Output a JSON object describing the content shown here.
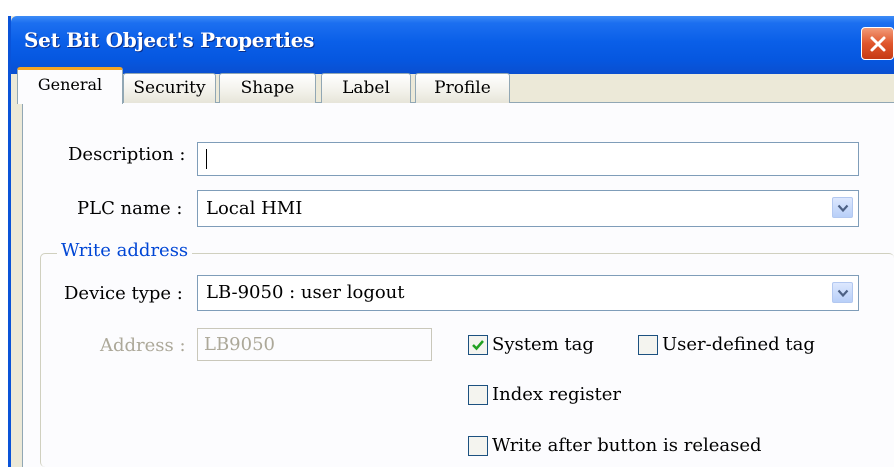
{
  "window": {
    "title": "Set Bit Object's Properties"
  },
  "tabs": [
    {
      "label": "General",
      "active": true
    },
    {
      "label": "Security",
      "active": false
    },
    {
      "label": "Shape",
      "active": false
    },
    {
      "label": "Label",
      "active": false
    },
    {
      "label": "Profile",
      "active": false
    }
  ],
  "general": {
    "description_label": "Description :",
    "description_value": "",
    "plc_name_label": "PLC name :",
    "plc_name_value": "Local HMI",
    "write_address_group": "Write address",
    "device_type_label": "Device type :",
    "device_type_value": "LB-9050 : user logout",
    "address_label": "Address :",
    "address_value": "LB9050",
    "system_tag_label": "System tag",
    "system_tag_checked": true,
    "user_defined_tag_label": "User-defined tag",
    "user_defined_tag_checked": false,
    "index_register_label": "Index register",
    "index_register_checked": false,
    "write_after_release_label": "Write after button is released",
    "write_after_release_checked": false
  },
  "colors": {
    "title_bar": "#0a5fe8",
    "close_button": "#e0562c",
    "window_bg": "#ece9d8",
    "panel_bg": "#fcfcfe",
    "active_tab_accent": "#f5a623",
    "group_label": "#0046d5",
    "disabled_text": "#aca899",
    "checkmark": "#21a121"
  },
  "icons": {
    "close": "close-icon",
    "dropdown": "chevron-down-icon",
    "check": "checkmark-icon"
  }
}
